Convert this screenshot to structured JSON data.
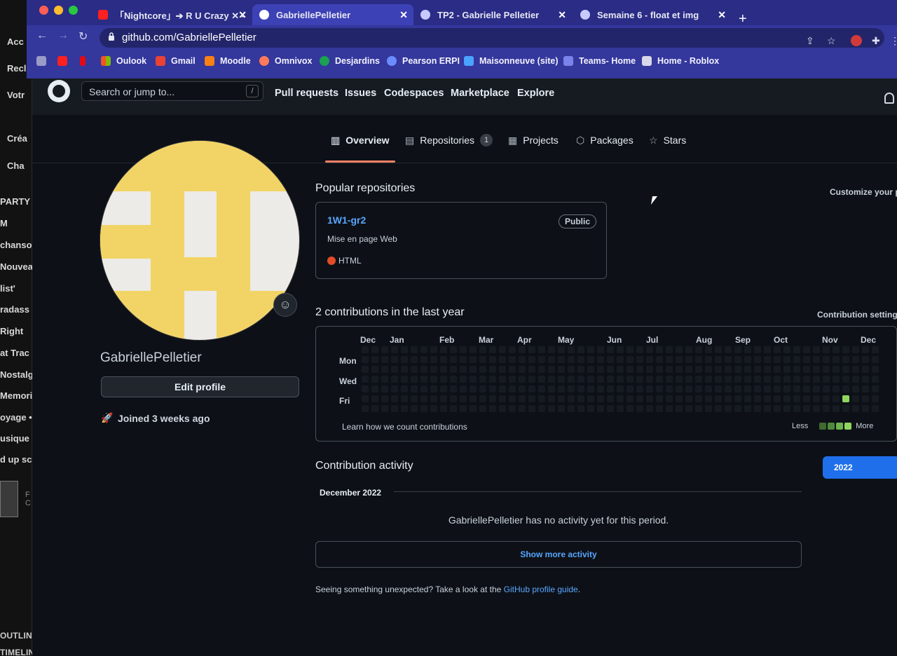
{
  "background_window": {
    "lines": [
      "Acc",
      "Recl",
      "Votr",
      "Créa",
      "Cha",
      "PARTY",
      "M",
      "chanso",
      "Nouvea",
      "list'",
      "radass",
      "Right",
      "at Trac",
      "Nostalg",
      "Memorie",
      "oyage •",
      "usique",
      "d up sc"
    ],
    "bottom": [
      "OUTLINE",
      "TIMELIN"
    ]
  },
  "browser": {
    "tabs": [
      {
        "label": "「Nightcore」➔ R U Crazy ✕ -",
        "icon_color": "#ff0000"
      },
      {
        "label": "GabriellePelletier",
        "icon_color": "#ffffff"
      },
      {
        "label": "TP2 - Gabrielle Pelletier",
        "icon_color": "#bfc3ff"
      },
      {
        "label": "Semaine 6 - float et img",
        "icon_color": "#bfc3ff"
      }
    ],
    "url": "github.com/GabriellePelletier",
    "bookmarks": [
      "Oulook",
      "Gmail",
      "Moodle",
      "Omnivox",
      "Desjardins",
      "Pearson ERPI",
      "Maisonneuve (site)",
      "Teams- Home",
      "Home - Roblox"
    ]
  },
  "github_header": {
    "search_placeholder": "Search or jump to...",
    "search_key": "/",
    "nav": [
      "Pull requests",
      "Issues",
      "Codespaces",
      "Marketplace",
      "Explore"
    ]
  },
  "profile": {
    "username": "GabriellePelletier",
    "edit_label": "Edit profile",
    "joined": "Joined 3 weeks ago",
    "tabs": [
      {
        "label": "Overview",
        "glyph": "▥"
      },
      {
        "label": "Repositories",
        "glyph": "▤",
        "count": "1"
      },
      {
        "label": "Projects",
        "glyph": "▦"
      },
      {
        "label": "Packages",
        "glyph": "⬡"
      },
      {
        "label": "Stars",
        "glyph": "☆"
      }
    ]
  },
  "popular": {
    "title": "Popular repositories",
    "customize": "Customize your pi",
    "repo": {
      "name": "1W1-gr2",
      "visibility": "Public",
      "description": "Mise en page Web",
      "language": "HTML"
    }
  },
  "contributions": {
    "title": "2 contributions in the last year",
    "settings": "Contribution settings",
    "months": [
      "Dec",
      "Jan",
      "Feb",
      "Mar",
      "Apr",
      "May",
      "Jun",
      "Jul",
      "Aug",
      "Sep",
      "Oct",
      "Nov",
      "Dec"
    ],
    "days": [
      "Mon",
      "Wed",
      "Fri"
    ],
    "learn": "Learn how we count contributions",
    "less": "Less",
    "more": "More",
    "colors": {
      "empty": "#161b22",
      "level1": "#0e4429",
      "level2": "#006d32",
      "level3": "#26a641",
      "level4": "#8fd660"
    }
  },
  "activity": {
    "title": "Contribution activity",
    "year": "2022",
    "month": "December 2022",
    "empty": "GabriellePelletier has no activity yet for this period.",
    "more": "Show more activity",
    "footer_prefix": "Seeing something unexpected? Take a look at the",
    "footer_link": "GitHub profile guide",
    "footer_suffix": "."
  }
}
